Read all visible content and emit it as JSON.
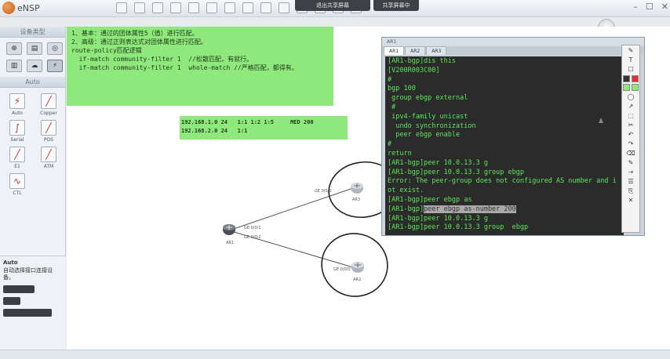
{
  "window": {
    "title": "eNSP"
  },
  "meeting_bar": {
    "leave_label": "退出共享屏幕",
    "share_label": "共享屏幕中"
  },
  "sidebar": {
    "device_header": "设备类型",
    "cable_header": "Auto",
    "cables": [
      {
        "label": "Auto",
        "icon": "auto-cable-icon",
        "glyph": "⚡"
      },
      {
        "label": "Copper",
        "icon": "copper-cable-icon",
        "glyph": "╱"
      },
      {
        "label": "Serial",
        "icon": "serial-cable-icon",
        "glyph": "∫"
      },
      {
        "label": "POS",
        "icon": "pos-cable-icon",
        "glyph": "╱"
      },
      {
        "label": "E1",
        "icon": "e1-cable-icon",
        "glyph": "╱"
      },
      {
        "label": "ATM",
        "icon": "atm-cable-icon",
        "glyph": "╱"
      },
      {
        "label": "CTL",
        "icon": "ctl-cable-icon",
        "glyph": "∿"
      }
    ],
    "description": {
      "title": "Auto",
      "text": "自动选择接口连接设备。"
    }
  },
  "notes": {
    "top_lines": [
      "1、基本：通过的团体属性5（值）进行匹配。",
      "2、高级：通过正则表达式对团体属性进行匹配。",
      "",
      "",
      "route-policy匹配逻辑",
      "  if-match community-filter 1  //松散匹配，有就行。",
      "  if-match community-filter 1  whole-match //严格匹配，都得有。"
    ],
    "route_lines": [
      "192.168.1.0 24   1:1 1:2 1:5     MED 200",
      "192.168.2.0 24   1:1"
    ]
  },
  "topology": {
    "devices": [
      {
        "name": "AR1"
      },
      {
        "name": "AR3"
      },
      {
        "name": "AR2"
      }
    ],
    "ports": [
      "GE 0/0/0",
      "GE 0/0/1",
      "GE 0/0/2",
      "GE 0/0/0"
    ]
  },
  "terminal": {
    "window_title": "AR1",
    "tabs": [
      "AR1",
      "AR2",
      "AR3"
    ],
    "lines": [
      "[AR1-bgp]dis this",
      "[V200R003C00]",
      "#",
      "bgp 100",
      " group ebgp external",
      " #",
      " ipv4-family unicast",
      "  undo synchronization",
      "  peer ebgp enable",
      "#",
      "return",
      "[AR1-bgp]peer 10.0.13.3 g",
      "[AR1-bgp]peer 10.0.13.3 group ebgp",
      "Error: The peer-group does not configured AS number and i",
      "ot exist.",
      "[AR1-bgp]peer ebgp as",
      "",
      "[AR1-bgp]peer 10.0.13.3 g",
      "[AR1-bgp]peer 10.0.13.3 group  ebgp"
    ],
    "highlight_prefix": "[AR1-bgp]",
    "highlight_text": "peer ebgp as-number 200"
  },
  "annotation_tools": [
    "✎",
    "T",
    "☐",
    "◯",
    "↗",
    "⬚",
    "✂",
    "↶",
    "↷",
    "⌫",
    "✎",
    "⇢",
    "☰",
    "⎘",
    "✕"
  ],
  "colors": {
    "note_green": "#8ee87b",
    "terminal_bg": "#2b2b2b",
    "terminal_text": "#5ce659",
    "annotation_ink": "#222222",
    "link_color": "#555555"
  }
}
